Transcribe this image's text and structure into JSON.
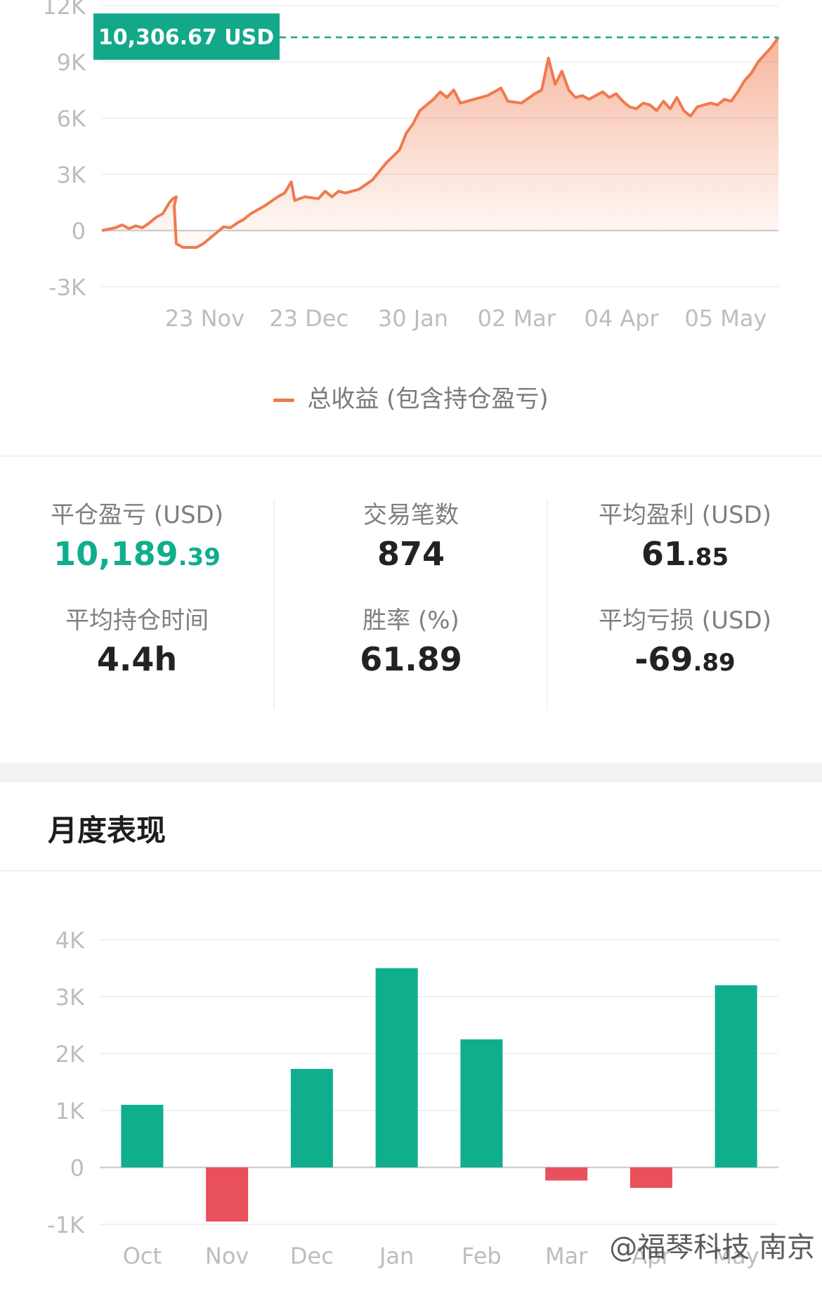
{
  "cumulative": {
    "chart_data": {
      "type": "area",
      "legend": "总收益 (包含持仓盈亏)",
      "y_ticks": [
        "12K",
        "9K",
        "6K",
        "3K",
        "0",
        "-3K"
      ],
      "y_tick_values": [
        12000,
        9000,
        6000,
        3000,
        0,
        -3000
      ],
      "ylim": [
        -3000,
        12000
      ],
      "x_ticks": [
        "23 Nov",
        "23 Dec",
        "30 Jan",
        "02 Mar",
        "04 Apr",
        "05 May"
      ],
      "x_tick_positions": [
        0.152,
        0.306,
        0.46,
        0.613,
        0.768,
        0.922
      ],
      "last_value_label": "10,306.67 USD",
      "last_value": 10306.67,
      "points": [
        [
          0.0,
          0
        ],
        [
          0.02,
          150
        ],
        [
          0.03,
          300
        ],
        [
          0.04,
          100
        ],
        [
          0.05,
          250
        ],
        [
          0.06,
          150
        ],
        [
          0.07,
          400
        ],
        [
          0.08,
          700
        ],
        [
          0.09,
          900
        ],
        [
          0.1,
          1500
        ],
        [
          0.105,
          1700
        ],
        [
          0.11,
          1800
        ],
        [
          0.107,
          1300
        ],
        [
          0.11,
          -700
        ],
        [
          0.12,
          -900
        ],
        [
          0.14,
          -900
        ],
        [
          0.15,
          -700
        ],
        [
          0.16,
          -400
        ],
        [
          0.17,
          -100
        ],
        [
          0.18,
          200
        ],
        [
          0.19,
          150
        ],
        [
          0.2,
          400
        ],
        [
          0.21,
          600
        ],
        [
          0.22,
          900
        ],
        [
          0.24,
          1300
        ],
        [
          0.26,
          1800
        ],
        [
          0.27,
          2000
        ],
        [
          0.28,
          2600
        ],
        [
          0.285,
          1600
        ],
        [
          0.3,
          1800
        ],
        [
          0.32,
          1700
        ],
        [
          0.33,
          2100
        ],
        [
          0.34,
          1800
        ],
        [
          0.35,
          2100
        ],
        [
          0.36,
          2000
        ],
        [
          0.38,
          2200
        ],
        [
          0.4,
          2700
        ],
        [
          0.42,
          3600
        ],
        [
          0.44,
          4300
        ],
        [
          0.45,
          5200
        ],
        [
          0.46,
          5700
        ],
        [
          0.47,
          6400
        ],
        [
          0.49,
          7000
        ],
        [
          0.5,
          7400
        ],
        [
          0.51,
          7100
        ],
        [
          0.52,
          7500
        ],
        [
          0.53,
          6800
        ],
        [
          0.55,
          7000
        ],
        [
          0.57,
          7200
        ],
        [
          0.59,
          7600
        ],
        [
          0.6,
          6900
        ],
        [
          0.62,
          6800
        ],
        [
          0.64,
          7300
        ],
        [
          0.65,
          7500
        ],
        [
          0.66,
          9200
        ],
        [
          0.67,
          7800
        ],
        [
          0.68,
          8500
        ],
        [
          0.69,
          7500
        ],
        [
          0.7,
          7100
        ],
        [
          0.71,
          7200
        ],
        [
          0.72,
          7000
        ],
        [
          0.73,
          7200
        ],
        [
          0.74,
          7400
        ],
        [
          0.75,
          7100
        ],
        [
          0.76,
          7300
        ],
        [
          0.77,
          6900
        ],
        [
          0.78,
          6600
        ],
        [
          0.79,
          6500
        ],
        [
          0.8,
          6800
        ],
        [
          0.81,
          6700
        ],
        [
          0.82,
          6400
        ],
        [
          0.83,
          6900
        ],
        [
          0.84,
          6500
        ],
        [
          0.85,
          7100
        ],
        [
          0.86,
          6400
        ],
        [
          0.87,
          6100
        ],
        [
          0.88,
          6600
        ],
        [
          0.89,
          6700
        ],
        [
          0.9,
          6800
        ],
        [
          0.91,
          6700
        ],
        [
          0.92,
          7000
        ],
        [
          0.93,
          6900
        ],
        [
          0.94,
          7400
        ],
        [
          0.95,
          8000
        ],
        [
          0.96,
          8400
        ],
        [
          0.97,
          9000
        ],
        [
          0.98,
          9400
        ],
        [
          0.99,
          9800
        ],
        [
          1.0,
          10306.67
        ]
      ]
    }
  },
  "stats": {
    "col1": {
      "label1": "平仓盈亏 (USD)",
      "value1_int": "10,189",
      "value1_dec": ".39",
      "label2": "平均持仓时间",
      "value2": "4.4h"
    },
    "col2": {
      "label1": "交易笔数",
      "value1": "874",
      "label2": "胜率 (%)",
      "value2": "61.89"
    },
    "col3": {
      "label1": "平均盈利 (USD)",
      "value1_int": "61",
      "value1_dec": ".85",
      "label2": "平均亏损 (USD)",
      "value2_int": "-69",
      "value2_dec": ".89"
    }
  },
  "monthly": {
    "title": "月度表现",
    "chart_data": {
      "type": "bar",
      "categories": [
        "Oct",
        "Nov",
        "Dec",
        "Jan",
        "Feb",
        "Mar",
        "Apr",
        "May"
      ],
      "values": [
        1100,
        -950,
        1730,
        3500,
        2250,
        -230,
        -360,
        3200
      ],
      "y_ticks": [
        "4K",
        "3K",
        "2K",
        "1K",
        "0",
        "-1K"
      ],
      "y_tick_values": [
        4000,
        3000,
        2000,
        1000,
        0,
        -1000
      ],
      "ylim": [
        -1000,
        4000
      ]
    }
  },
  "colors": {
    "line": "#f07a4e",
    "positive": "#0fae8c",
    "negative": "#e8505b",
    "label_bg": "#13a889"
  },
  "watermark": "@福琴科技 南京"
}
